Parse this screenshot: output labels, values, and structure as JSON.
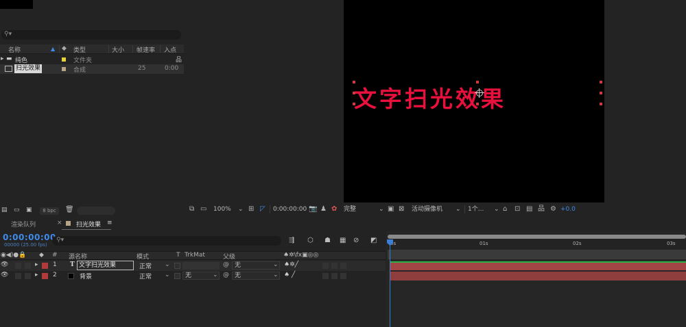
{
  "project": {
    "search_icon": "search-icon",
    "columns": [
      "名称",
      "类型",
      "大小",
      "帧速率",
      "入点"
    ],
    "items": [
      {
        "name": "纯色",
        "type": "文件夹",
        "size": "",
        "fps": "",
        "in": "",
        "swatch": "#e6d23b"
      },
      {
        "name": "扫光效果",
        "type": "合成",
        "size": "",
        "fps": "25",
        "in": "0:00",
        "swatch": "#b8a486"
      }
    ],
    "bpc": "8 bpc"
  },
  "viewer": {
    "comp_text": "文字扫光效果",
    "zoom": "100%",
    "timecode": "0:00:00:00",
    "resolution": "完整",
    "camera": "活动摄像机",
    "views": "1个...",
    "exposure": "+0.0"
  },
  "tabs": {
    "render_queue": "渲染队列",
    "comp_tab": "扫光效果"
  },
  "timeline": {
    "timecode": "0:00:00:00",
    "fps_note": "00000 (25.00 fps)",
    "headers": {
      "num": "#",
      "source": "源名称",
      "mode": "模式",
      "t": "T",
      "trkmat": "TrkMat",
      "parent": "父级"
    },
    "layers": [
      {
        "num": "1",
        "type_icon": "T",
        "name": "文字扫光效果",
        "mode": "正常",
        "trkmat": "",
        "parent": "无",
        "label": "#b33a3a",
        "bar": "#a34545"
      },
      {
        "num": "2",
        "type_icon": "",
        "name": "背景",
        "mode": "正常",
        "trkmat": "无",
        "parent": "无",
        "label": "#b33a3a",
        "bar": "#8f3d3d"
      }
    ],
    "ruler": [
      "0s",
      "01s",
      "02s",
      "03s"
    ]
  }
}
